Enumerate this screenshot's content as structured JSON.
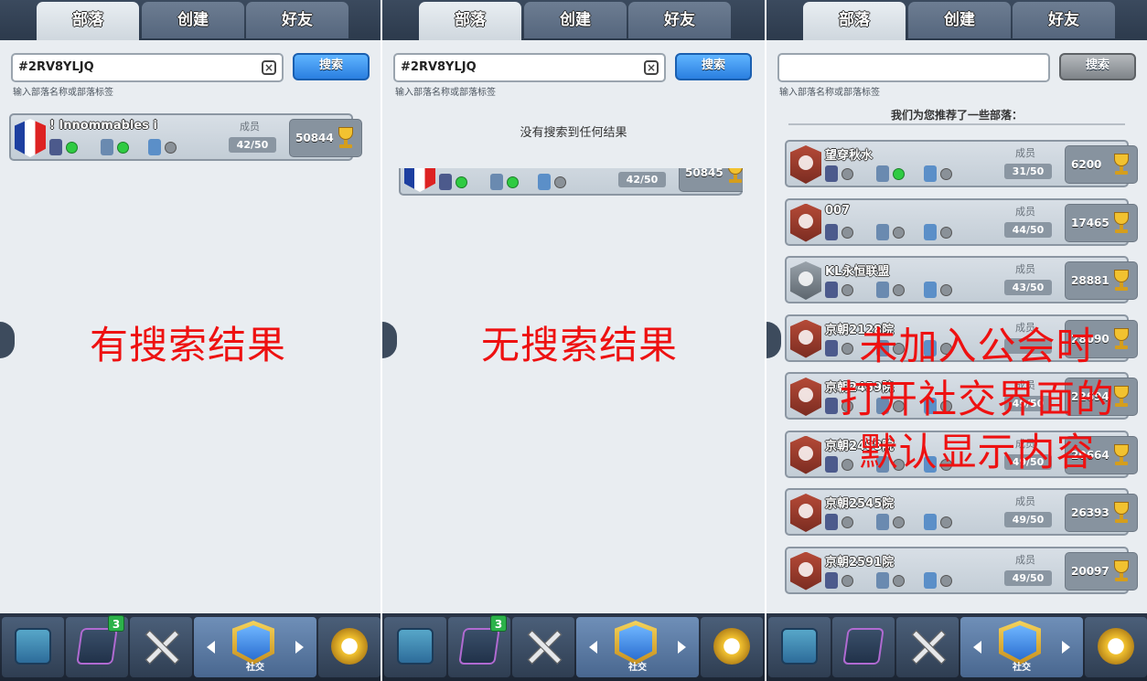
{
  "tabs": {
    "tribe": "部落",
    "create": "创建",
    "friends": "好友"
  },
  "search": {
    "value": "#2RV8YLJQ",
    "button": "搜索",
    "hint": "输入部落名称或部落标签"
  },
  "labels": {
    "members": "成员"
  },
  "panel1": {
    "caption": "有搜索结果",
    "clan": {
      "name": "! Innommables i",
      "members": "42/50",
      "trophies": "50844"
    }
  },
  "panel2": {
    "caption": "无搜索结果",
    "no_result": "没有搜索到任何结果",
    "clan": {
      "members": "42/50",
      "trophies": "50845"
    }
  },
  "panel3": {
    "caption_lines": [
      "未加入公会时",
      "打开社交界面的",
      "默认显示内容"
    ],
    "recommend_title": "我们为您推荐了一些部落：",
    "clans": [
      {
        "name": "望穿秋水",
        "members": "31/50",
        "trophies": "6200",
        "badge": "red"
      },
      {
        "name": "007",
        "members": "44/50",
        "trophies": "17465",
        "badge": "red"
      },
      {
        "name": "KL永恒联盟",
        "members": "43/50",
        "trophies": "28881",
        "badge": "gray"
      },
      {
        "name": "京朝2128院",
        "members": "",
        "trophies": "28090",
        "badge": "red"
      },
      {
        "name": "京朝2459院",
        "members": "49/50",
        "trophies": "22694",
        "badge": "red"
      },
      {
        "name": "京朝2498院",
        "members": "49/50",
        "trophies": "20664",
        "badge": "red"
      },
      {
        "name": "京朝2545院",
        "members": "49/50",
        "trophies": "26393",
        "badge": "red"
      },
      {
        "name": "京朝2591院",
        "members": "49/50",
        "trophies": "20097",
        "badge": "red"
      }
    ]
  },
  "nav": {
    "social": "社交",
    "cards_badge": "3"
  }
}
